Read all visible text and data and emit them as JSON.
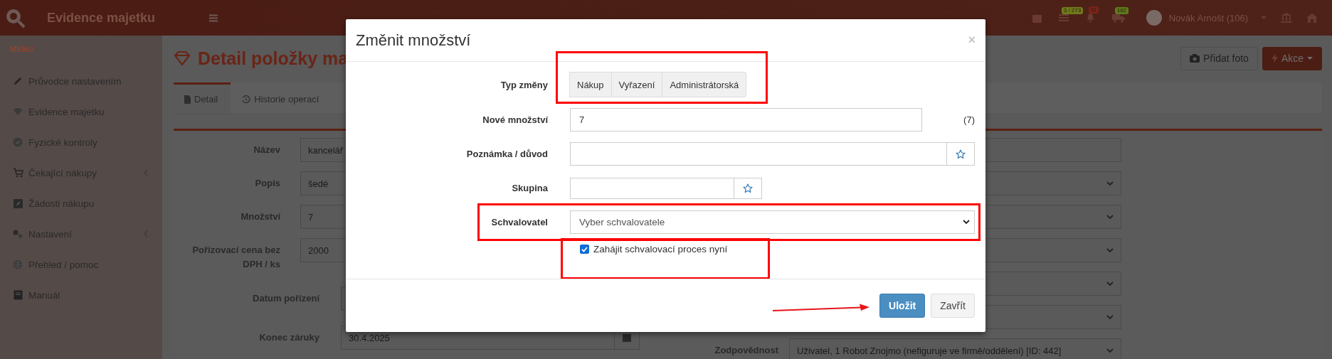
{
  "topbar": {
    "app_title": "Evidence majetku",
    "badges": [
      {
        "text": "3 / 273",
        "color": "#6f7a1c"
      },
      {
        "text": "11",
        "color": "#7a2418"
      },
      {
        "text": "162",
        "color": "#5f7a1c"
      }
    ],
    "user": "Novák Arnošt (106)"
  },
  "sidebar": {
    "heading": "MENU",
    "items": [
      {
        "label": "Průvodce nastavením",
        "expandable": false
      },
      {
        "label": "Evidence majetku",
        "expandable": false
      },
      {
        "label": "Fyzické kontroly",
        "expandable": false
      },
      {
        "label": "Čekající nákupy",
        "expandable": true
      },
      {
        "label": "Žádosti nákupu",
        "expandable": false
      },
      {
        "label": "Nastavení",
        "expandable": true
      },
      {
        "label": "Přehled / pomoc",
        "expandable": false
      },
      {
        "label": "Manuál",
        "expandable": false
      }
    ]
  },
  "page": {
    "title": "Detail položky ma",
    "buttons": [
      {
        "label": "Přidat foto",
        "kind": "default"
      },
      {
        "label": "Akce",
        "kind": "primary"
      }
    ],
    "tabs": [
      {
        "label": "Detail",
        "selected": true
      },
      {
        "label": "Historie operací",
        "selected": false
      }
    ],
    "form_left": [
      {
        "kind": "input",
        "label": "Název",
        "value": "kancelář"
      },
      {
        "kind": "input",
        "label": "Popis",
        "value": "šedé"
      },
      {
        "kind": "input",
        "label": "Množství",
        "value": "7"
      },
      {
        "kind": "input",
        "label": "Pořizovací cena bez DPH / ks",
        "value": "2000"
      },
      {
        "kind": "date",
        "label": "Datum pořízení"
      },
      {
        "kind": "date",
        "label": "Konec záruky",
        "value": "30.4.2025"
      }
    ],
    "form_right": [
      {
        "kind": "input"
      },
      {
        "kind": "select"
      },
      {
        "kind": "select"
      },
      {
        "kind": "select"
      },
      {
        "kind": "select"
      },
      {
        "kind": "select"
      },
      {
        "kind": "select",
        "label": "Zodpovědnost",
        "value": "Uživatel, 1 Robot Znojmo (nefiguruje ve firmě/oddělení) [ID: 442]"
      }
    ]
  },
  "dialog": {
    "title": "Změnit množství",
    "close": "×",
    "fields": [
      {
        "kind": "segmented",
        "label": "Typ změny",
        "highlighted": true,
        "options": [
          {
            "label": "Nákup",
            "selected": false
          },
          {
            "label": "Vyřazení",
            "selected": false
          },
          {
            "label": "Administrátorská",
            "selected": false
          }
        ]
      },
      {
        "kind": "input",
        "label": "Nové množství",
        "value": "7",
        "note": "(7)",
        "highlighted": false
      },
      {
        "kind": "favorite_input",
        "label": "Poznámka / důvod",
        "wide": true,
        "highlighted": false
      },
      {
        "kind": "favorite_input",
        "label": "Skupina",
        "wide": false,
        "highlighted": false
      },
      {
        "kind": "select",
        "label": "Schvalovatel",
        "value": "Vyber schvalovatele",
        "highlighted": true
      }
    ],
    "checkbox": {
      "label": "Zahájit schvalovací proces nyní",
      "checked": true,
      "highlighted": true
    },
    "buttons": [
      {
        "label": "Uložit",
        "kind": "primary",
        "pointed": true
      },
      {
        "label": "Zavřít",
        "kind": "default",
        "pointed": false
      }
    ]
  }
}
